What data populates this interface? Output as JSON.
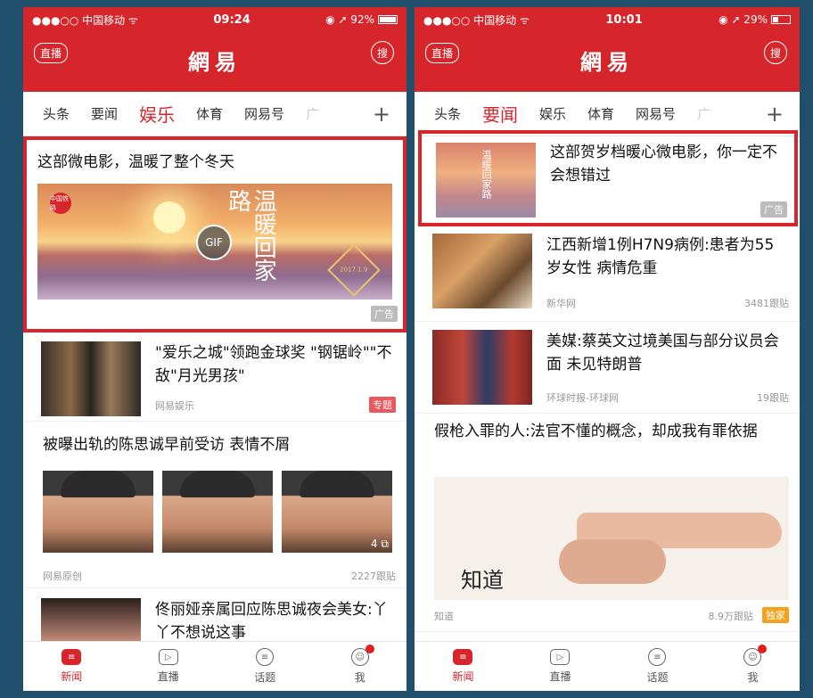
{
  "left": {
    "status": {
      "carrier": "●●●○○ 中国移动 ᯤ",
      "time": "09:24",
      "battery_text": "◉ ➚ 92%",
      "battery_level": 0.92
    },
    "header": {
      "live": "直播",
      "logo": "網易",
      "search": "搜"
    },
    "tabs": [
      {
        "label": "头条"
      },
      {
        "label": "要闻"
      },
      {
        "label": "娱乐"
      },
      {
        "label": "体育"
      },
      {
        "label": "网易号"
      },
      {
        "label": "广"
      }
    ],
    "ad": {
      "title": "这部微电影，温暖了整个冬天",
      "gif": "GIF",
      "calligraphy": "温暖回家路",
      "badge": "中国铁路",
      "stamp": "2017.1.9",
      "tag": "广告"
    },
    "item1": {
      "title": "\"爱乐之城\"领跑金球奖 \"钢锯岭\"\"不敌\"月光男孩\"",
      "source": "网易娱乐",
      "tag": "专题"
    },
    "item2": {
      "title": "被曝出轨的陈思诚早前受访 表情不屑",
      "source": "网易原创",
      "count": "2227跟贴",
      "photos": "4"
    },
    "item3": {
      "title": "佟丽娅亲属回应陈思诚夜会美女:丫丫不想说这事"
    },
    "tabbar": [
      {
        "label": "新闻"
      },
      {
        "label": "直播"
      },
      {
        "label": "话题"
      },
      {
        "label": "我"
      }
    ]
  },
  "right": {
    "status": {
      "carrier": "●●●○○ 中国移动 ᯤ",
      "time": "10:01",
      "battery_text": "◉ ➚ 29%",
      "battery_level": 0.29
    },
    "header": {
      "live": "直播",
      "logo": "網易",
      "search": "搜"
    },
    "tabs": [
      {
        "label": "头条"
      },
      {
        "label": "要闻"
      },
      {
        "label": "娱乐"
      },
      {
        "label": "体育"
      },
      {
        "label": "网易号"
      },
      {
        "label": "广"
      }
    ],
    "ad": {
      "title": "这部贺岁档暖心微电影，你一定不会想错过",
      "calligraphy": "温暖回家路",
      "tag": "广告"
    },
    "item1": {
      "title": "江西新增1例H7N9病例:患者为55岁女性 病情危重",
      "source": "新华网",
      "count": "3481跟贴"
    },
    "item2": {
      "title": "美媒:蔡英文过境美国与部分议员会面 未见特朗普",
      "source": "环球时报-环球网",
      "count": "19跟贴"
    },
    "item3": {
      "title": "假枪入罪的人:法官不懂的概念，却成我有罪依据",
      "logo": "知道",
      "source": "知道",
      "count": "8.9万跟贴",
      "tag": "独家"
    },
    "tabbar": [
      {
        "label": "新闻"
      },
      {
        "label": "直播"
      },
      {
        "label": "话题"
      },
      {
        "label": "我"
      }
    ]
  },
  "colors": {
    "brand_red": "#d6262c",
    "frame": "#1f4f6a",
    "tag_orange": "#f4a21d"
  },
  "icons": {
    "news": "news-icon",
    "live": "play-icon",
    "topic": "chat-icon",
    "me": "user-icon"
  }
}
